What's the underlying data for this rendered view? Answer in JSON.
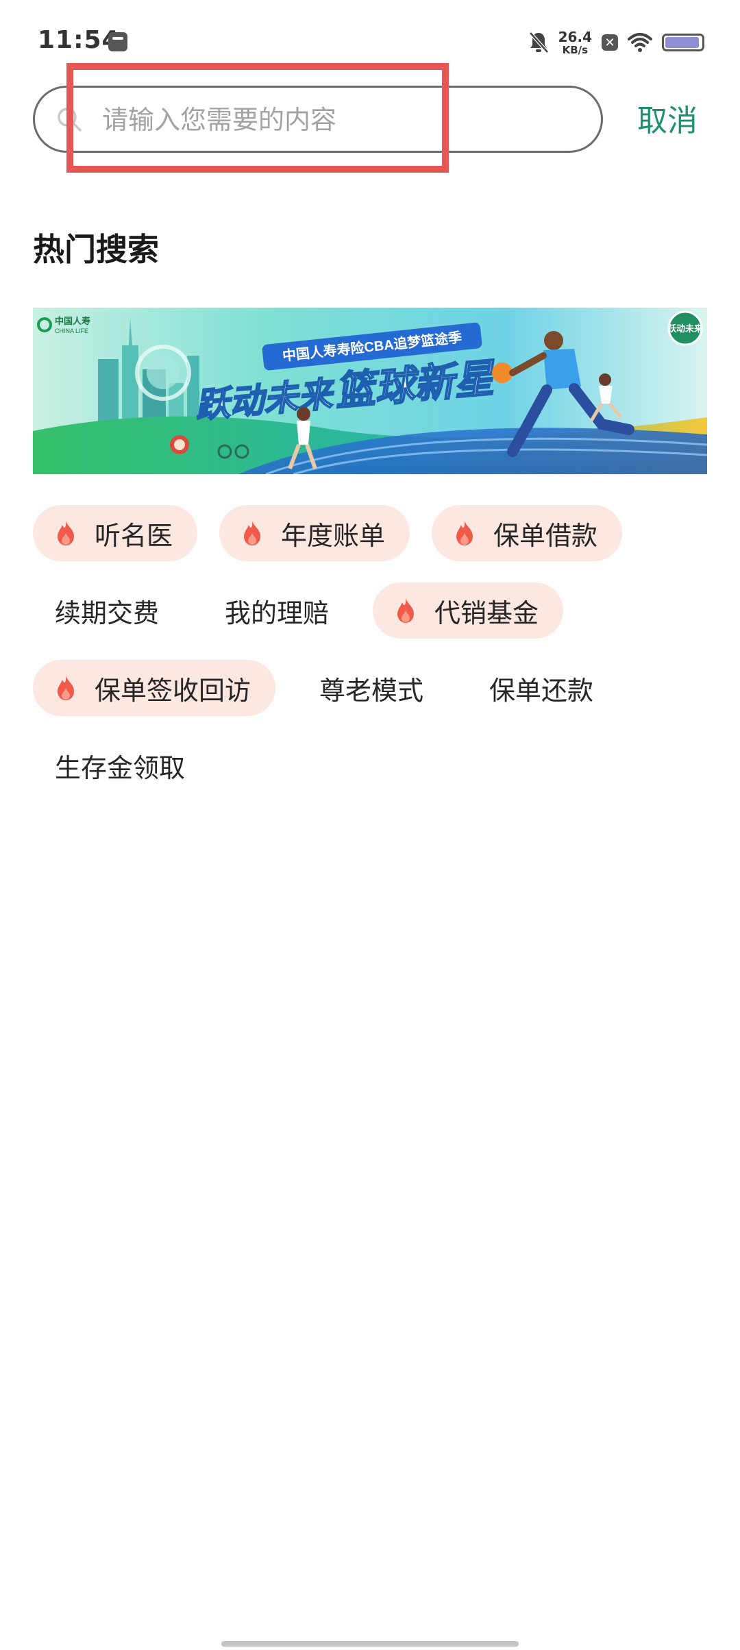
{
  "status_bar": {
    "time": "11:54",
    "net_speed_value": "26.4",
    "net_speed_unit": "KB/s",
    "close_badge": "✕",
    "battery_level": 0.95
  },
  "search": {
    "placeholder": "请输入您需要的内容",
    "value": "",
    "cancel_label": "取消"
  },
  "hot_search": {
    "title": "热门搜索"
  },
  "banner": {
    "brand_cn": "中国人寿",
    "brand_en": "CHINA LIFE",
    "subtitle": "中国人寿寿险CBA追梦篮途季",
    "headline_a": "跃动未来",
    "headline_b": "篮球新星",
    "badge": "跃动未来"
  },
  "tag_rows": [
    [
      {
        "label": "听名医",
        "hot": true
      },
      {
        "label": "年度账单",
        "hot": true
      },
      {
        "label": "保单借款",
        "hot": true
      }
    ],
    [
      {
        "label": "续期交费",
        "hot": false
      },
      {
        "label": "我的理赔",
        "hot": false
      },
      {
        "label": "代销基金",
        "hot": true
      }
    ],
    [
      {
        "label": "保单签收回访",
        "hot": true
      },
      {
        "label": "尊老模式",
        "hot": false
      },
      {
        "label": "保单还款",
        "hot": false
      }
    ],
    [
      {
        "label": "生存金领取",
        "hot": false
      }
    ]
  ],
  "colors": {
    "accent": "#1f8f72",
    "hot_tag_bg": "#fde7e1",
    "flame": "#f05a4a",
    "highlight": "#e65655"
  }
}
